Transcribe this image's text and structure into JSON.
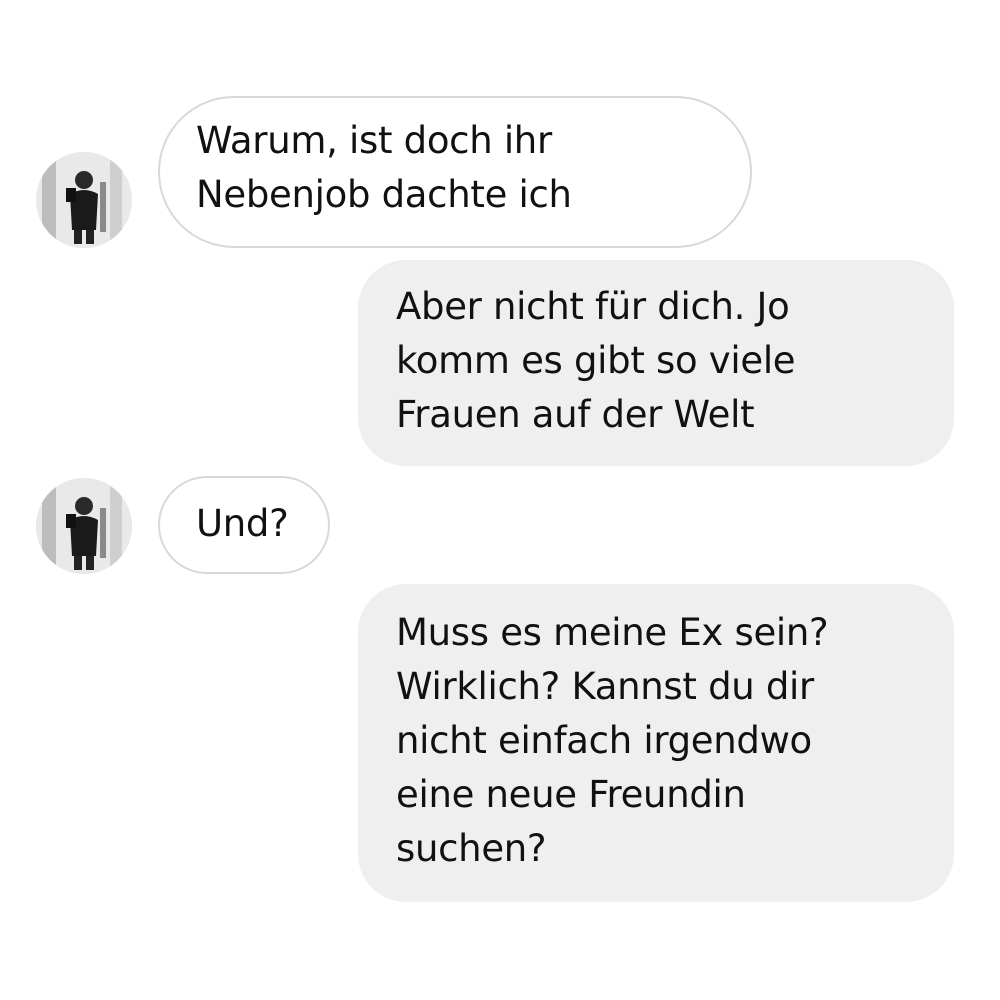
{
  "conversation": {
    "messages": [
      {
        "sender": "other",
        "avatar_icon": "profile-photo-icon",
        "lines": [
          "Warum, ist doch ihr",
          "Nebenjob dachte ich"
        ]
      },
      {
        "sender": "me",
        "lines": [
          "Aber nicht für dich. Jo",
          "komm es gibt so viele",
          "Frauen auf der Welt"
        ]
      },
      {
        "sender": "other",
        "avatar_icon": "profile-photo-icon",
        "lines": [
          "Und?"
        ]
      },
      {
        "sender": "me",
        "lines": [
          "Muss es meine Ex sein?",
          "Wirklich? Kannst du dir",
          "nicht einfach irgendwo",
          "eine neue Freundin",
          "suchen?"
        ]
      }
    ]
  },
  "colors": {
    "incoming_bubble": "#ffffff",
    "incoming_border": "#d9d9d9",
    "outgoing_bubble": "#efefef",
    "text": "#111111"
  }
}
